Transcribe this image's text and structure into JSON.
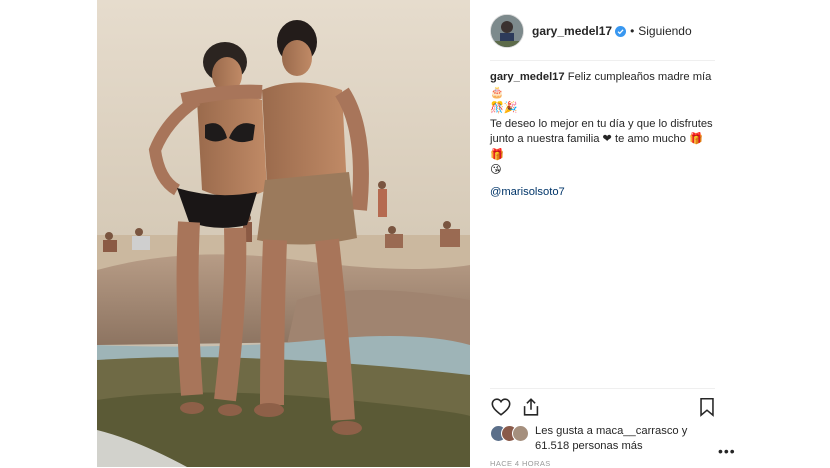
{
  "post": {
    "username": "gary_medel17",
    "follow_separator": "•",
    "follow_status": "Siguiendo"
  },
  "caption": {
    "username": "gary_medel17",
    "line1": "Feliz cumpleaños madre mía 🎂",
    "line1b": "🎊🎉",
    "line2": "Te deseo lo mejor en tu día y que lo disfrutes",
    "line3": "junto a nuestra familia ❤ te amo mucho 🎁🎁",
    "line4": "😘",
    "mention": "@marisolsoto7"
  },
  "likes": {
    "line1": "Les gusta a maca__carrasco y",
    "line2": "61.518 personas más"
  },
  "timestamp": "HACE 4 HORAS",
  "icons": {
    "avatar": "profile-avatar",
    "verified": "verified-badge-icon",
    "like": "heart-outline-icon",
    "share": "share-icon",
    "save": "bookmark-icon",
    "more": "more-options-icon"
  },
  "colors": {
    "verified": "#3897f0",
    "mention": "#003569",
    "timestamp": "#999999"
  }
}
